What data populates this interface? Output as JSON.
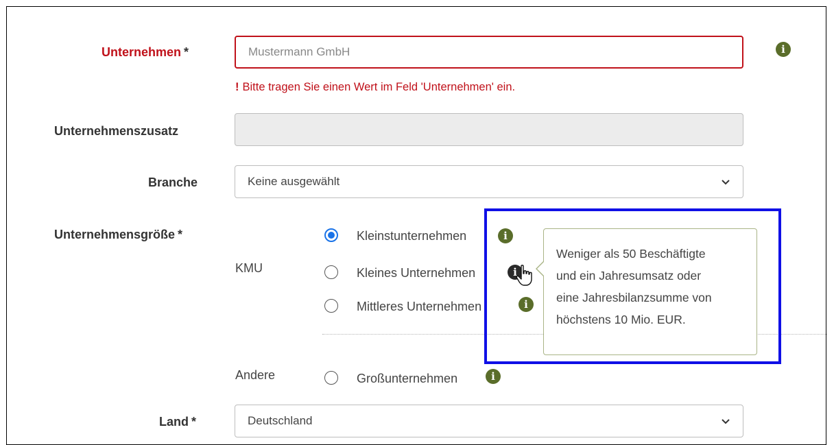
{
  "form": {
    "company": {
      "label": "Unternehmen",
      "required_mark": "*",
      "placeholder": "Mustermann GmbH",
      "error_mark": "!",
      "error": "Bitte tragen Sie einen Wert im Feld 'Unternehmen' ein."
    },
    "company_suffix": {
      "label": "Unternehmenszusatz",
      "value": ""
    },
    "industry": {
      "label": "Branche",
      "value": "Keine ausgewählt"
    },
    "size": {
      "label": "Unternehmensgröße",
      "required_mark": "*",
      "kmu_label": "KMU",
      "other_label": "Andere",
      "options": [
        {
          "label": "Kleinstunternehmen",
          "checked": true
        },
        {
          "label": "Kleines Unternehmen",
          "checked": false
        },
        {
          "label": "Mittleres Unternehmen",
          "checked": false
        },
        {
          "label": "Großunternehmen",
          "checked": false
        }
      ]
    },
    "country": {
      "label": "Land",
      "required_mark": "*",
      "value": "Deutschland"
    }
  },
  "tooltip": {
    "lines": [
      "Weniger als 50 Beschäftigte",
      "und ein Jahresumsatz oder",
      "eine Jahresbilanzsumme von",
      "höchstens 10 Mio. EUR."
    ]
  },
  "colors": {
    "error": "#c0111a",
    "info_icon": "#5a6d2a",
    "radio_checked": "#1a73e8",
    "highlight_box": "#1010e6"
  },
  "icons": {
    "info": "i",
    "select_arrow": "chevron-down-icon",
    "cursor": "hand-pointer-icon"
  }
}
